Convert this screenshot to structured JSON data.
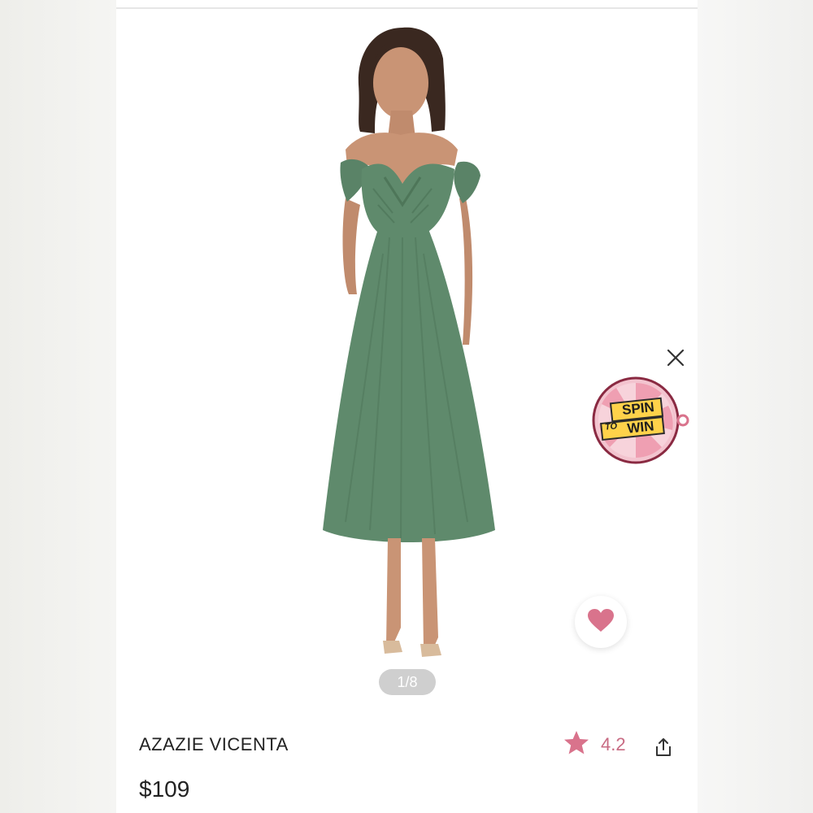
{
  "product": {
    "image_counter": "1/8",
    "title": "AZAZIE VICENTA",
    "price": "$109",
    "rating": "4.2"
  },
  "promo": {
    "line1": "SPIN",
    "line2": "TO",
    "line3": "WIN"
  },
  "icons": {
    "wishlist": "heart-icon",
    "close": "close-icon",
    "rating": "star-icon",
    "share": "share-icon"
  },
  "colors": {
    "accent": "#d9738c",
    "dress": "#5f8a6c",
    "text": "#222222",
    "indicator_bg": "#cfcfcf"
  }
}
